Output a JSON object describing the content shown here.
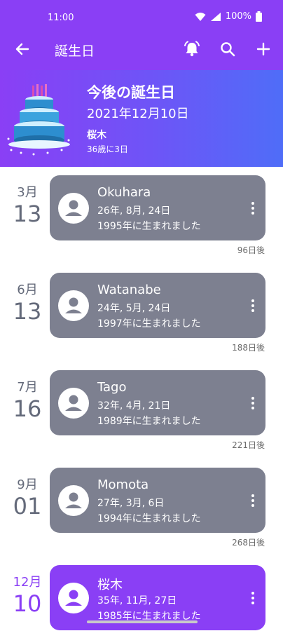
{
  "status_bar": {
    "time": "11:00",
    "battery": "100%"
  },
  "app_bar": {
    "title": "誕生日"
  },
  "header": {
    "title": "今後の誕生日",
    "date": "2021年12月10日",
    "name": "桜木",
    "age": "36歳に3日"
  },
  "entries": [
    {
      "month": "3月",
      "day": "13",
      "name": "Okuhara",
      "age": "26年, 8月, 24日",
      "born": "1995年に生まれました",
      "days_until": "96日後"
    },
    {
      "month": "6月",
      "day": "13",
      "name": "Watanabe",
      "age": "24年, 5月, 24日",
      "born": "1997年に生まれました",
      "days_until": "188日後"
    },
    {
      "month": "7月",
      "day": "16",
      "name": "Tago",
      "age": "32年, 4月, 21日",
      "born": "1989年に生まれました",
      "days_until": "221日後"
    },
    {
      "month": "9月",
      "day": "01",
      "name": "Momota",
      "age": "27年, 3月, 6日",
      "born": "1994年に生まれました",
      "days_until": "268日後"
    },
    {
      "month": "12月",
      "day": "10",
      "name": "桜木",
      "age": "35年, 11月, 27日",
      "born": "1985年に生まれました",
      "days_until": ""
    }
  ],
  "icons": {
    "back": "arrow-left-icon",
    "alarm": "alarm-bell-icon",
    "search": "search-icon",
    "add": "plus-icon",
    "avatar": "person-icon",
    "more": "more-vertical-icon"
  },
  "colors": {
    "primary": "#8a3ff5",
    "gradient_end": "#4f6df8",
    "card_gray": "#7d8090",
    "date_gray": "#646a7a"
  }
}
